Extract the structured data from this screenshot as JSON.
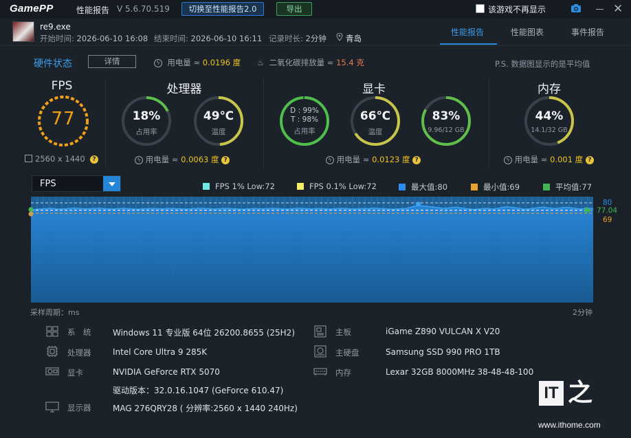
{
  "titlebar": {
    "logo": "GamePP",
    "title": "性能报告",
    "version": "V 5.6.70.519",
    "switch_button": "切换至性能报告2.0",
    "export_button": "导出",
    "dont_show_label": "该游戏不再显示"
  },
  "game": {
    "name": "re9.exe",
    "start_label": "开始时间: ",
    "start_value": "2026-06-10 16:08",
    "end_label": "结束时间: ",
    "end_value": "2026-06-10 16:11",
    "duration_label": "记录时长: ",
    "duration_value": "2分钟",
    "location": "青岛"
  },
  "tabs": [
    {
      "label": "性能报告",
      "active": true
    },
    {
      "label": "性能图表",
      "active": false
    },
    {
      "label": "事件报告",
      "active": false
    }
  ],
  "hardware": {
    "title": "硬件状态",
    "detail_button": "详情",
    "power_label": "用电量 ≈ ",
    "power_value": "0.0196 度",
    "co2_label": "二氧化碳排放量 ≈ ",
    "co2_value": "15.4 克",
    "note": "P.S. 数据图显示的是平均值"
  },
  "panels": {
    "fps": {
      "title": "FPS",
      "value": "77",
      "resolution": "2560 x 1440"
    },
    "cpu": {
      "title": "处理器",
      "usage_value": "18%",
      "usage_label": "占用率",
      "usage_fraction": 0.18,
      "temp_value": "49℃",
      "temp_label": "温度",
      "temp_fraction": 0.49,
      "power_label": "用电量 ≈ ",
      "power_value": "0.0063 度"
    },
    "gpu": {
      "title": "显卡",
      "d_label": "D : 99%",
      "t_label": "T : 98%",
      "usage_label": "占用率",
      "usage_fraction": 0.99,
      "temp_value": "66℃",
      "temp_label": "温度",
      "temp_fraction": 0.66,
      "vram_value": "83%",
      "vram_sub": "9.96/12 GB",
      "vram_fraction": 0.83,
      "power_label": "用电量 ≈ ",
      "power_value": "0.0123 度"
    },
    "mem": {
      "title": "内存",
      "usage_value": "44%",
      "usage_sub": "14.1/32 GB",
      "usage_fraction": 0.44,
      "power_label": "用电量 ≈ ",
      "power_value": "0.001 度"
    }
  },
  "chart": {
    "selected_metric": "FPS",
    "legend": [
      {
        "label": "FPS 1% Low:72",
        "color": "#6fe7e6"
      },
      {
        "label": "FPS 0.1% Low:72",
        "color": "#f3ee6a"
      },
      {
        "label": "最大值:80",
        "color": "#2c8ee8"
      },
      {
        "label": "最小值:69",
        "color": "#e8a32a"
      },
      {
        "label": "平均值:77",
        "color": "#44b553"
      }
    ],
    "x_label_left": "采样周期：ms",
    "x_label_right": "2分钟",
    "max_label": "80",
    "avg_label": "77.04",
    "min_label": "69"
  },
  "chart_data": {
    "type": "area",
    "ylim": [
      0,
      80
    ],
    "max": 80,
    "min": 69,
    "avg": 77.04,
    "values": [
      76.2,
      76.8,
      77.1,
      77.4,
      77.0,
      76.9,
      77.3,
      77.6,
      77.2,
      77.0,
      77.3,
      77.5,
      77.1,
      76.9,
      77.2,
      77.4,
      77.0,
      76.8,
      77.1,
      77.3,
      77.2,
      77.0,
      77.4,
      77.2,
      77.1,
      76.9,
      77.2,
      77.5,
      77.3,
      77.0,
      77.1,
      77.4,
      77.2,
      77.0,
      76.8,
      77.1,
      77.3,
      77.0,
      77.2,
      77.4,
      77.1,
      76.9,
      77.2,
      77.5,
      77.2,
      77.0,
      77.3,
      77.1,
      76.9,
      77.2,
      77.4,
      77.1,
      77.0,
      77.3,
      77.2,
      77.6,
      77.3,
      77.0,
      76.8,
      77.1,
      77.3,
      78.4,
      79.6,
      79.1,
      78.6,
      78.0,
      77.4,
      77.8,
      78.3,
      77.6,
      77.0,
      76.6,
      77.1,
      77.4,
      76.9,
      77.6,
      78.6,
      78.2,
      77.5,
      76.8,
      77.2,
      77.8,
      78.4,
      77.6,
      77.2,
      77.9,
      78.2,
      77.4,
      76.9,
      77.6,
      77.2
    ]
  },
  "system": {
    "os_label": "系　统",
    "os_value": "Windows 11 专业版 64位 26200.8655 (25H2)",
    "cpu_label": "处理器",
    "cpu_value": "Intel Core Ultra 9 285K",
    "gpu_label": "显卡",
    "gpu_value": "NVIDIA GeForce RTX 5070",
    "driver_value": "驱动版本：32.0.16.1047 (GeForce 610.47)",
    "monitor_label": "显示器",
    "monitor_value": "MAG 276QRY28 ( 分辨率:2560 x 1440 240Hz)",
    "board_label": "主板",
    "board_value": "iGame Z890 VULCAN X V20",
    "disk_label": "主硬盘",
    "disk_value": "Samsung SSD 990 PRO 1TB",
    "ram_label": "内存",
    "ram_value": "Lexar 32GB 8000MHz 38-48-48-100"
  },
  "watermark": {
    "box": "IT",
    "char": "之",
    "url": "www.ithome.com"
  }
}
